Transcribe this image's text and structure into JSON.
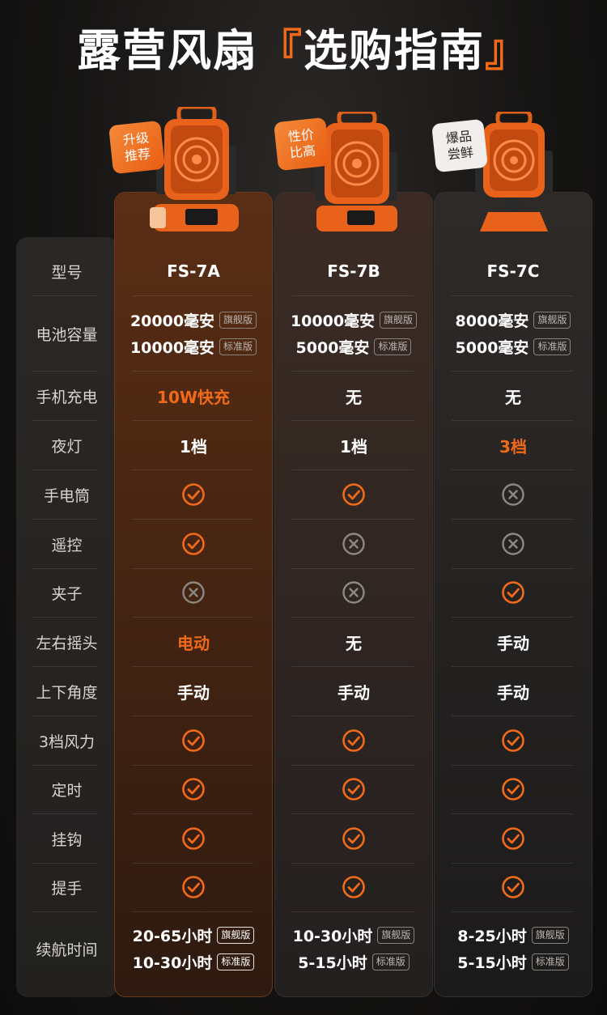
{
  "title": {
    "main": "露营风扇",
    "accent_open": "『",
    "accent_text": "选购指南",
    "accent_close": "』"
  },
  "badges": {
    "a": [
      "升级",
      "推荐"
    ],
    "b": [
      "性价",
      "比高"
    ],
    "c": [
      "爆品",
      "尝鲜"
    ]
  },
  "colors": {
    "accent": "#f06a1a",
    "check": "#f06a1a",
    "cross": "#8c8884"
  },
  "labels": {
    "model": "型号",
    "battery": "电池容量",
    "charging": "手机充电",
    "nightlight": "夜灯",
    "flashlight": "手电筒",
    "remote": "遥控",
    "clip": "夹子",
    "swing_lr": "左右摇头",
    "tilt_ud": "上下角度",
    "wind": "3档风力",
    "timer": "定时",
    "hook": "挂钩",
    "handle": "提手",
    "runtime": "续航时间"
  },
  "tags": {
    "flagship": "旗舰版",
    "standard": "标准版"
  },
  "products": [
    {
      "model": "FS-7A",
      "battery": [
        "20000毫安",
        "10000毫安"
      ],
      "charging": "10W快充",
      "nightlight": "1档",
      "flashlight": "check",
      "remote": "check",
      "clip": "cross",
      "swing_lr": "电动",
      "tilt_ud": "手动",
      "wind": "check",
      "timer": "check",
      "hook": "check",
      "handle": "check",
      "runtime": [
        "20-65小时",
        "10-30小时"
      ]
    },
    {
      "model": "FS-7B",
      "battery": [
        "10000毫安",
        "5000毫安"
      ],
      "charging": "无",
      "nightlight": "1档",
      "flashlight": "check",
      "remote": "cross",
      "clip": "cross",
      "swing_lr": "无",
      "tilt_ud": "手动",
      "wind": "check",
      "timer": "check",
      "hook": "check",
      "handle": "check",
      "runtime": [
        "10-30小时",
        "5-15小时"
      ]
    },
    {
      "model": "FS-7C",
      "battery": [
        "8000毫安",
        "5000毫安"
      ],
      "charging": "无",
      "nightlight": "3档",
      "flashlight": "cross",
      "remote": "cross",
      "clip": "check",
      "swing_lr": "手动",
      "tilt_ud": "手动",
      "wind": "check",
      "timer": "check",
      "hook": "check",
      "handle": "check",
      "runtime": [
        "8-25小时",
        "5-15小时"
      ]
    }
  ]
}
